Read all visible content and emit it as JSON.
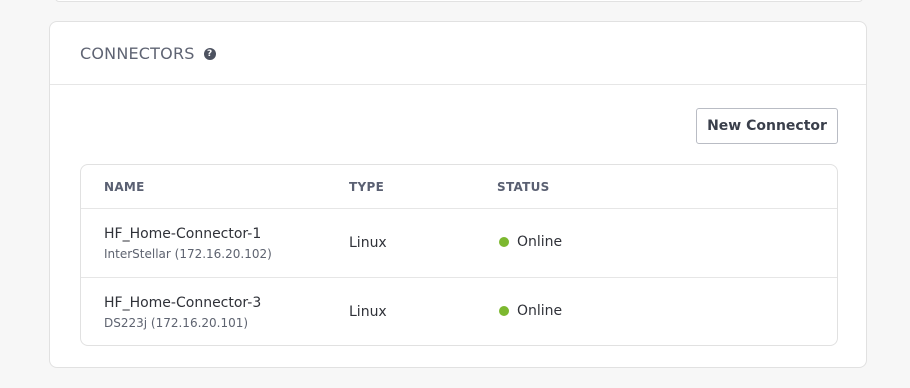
{
  "panel": {
    "title": "CONNECTORS",
    "help_icon": "question-circle-icon",
    "new_button_label": "New Connector"
  },
  "table": {
    "headers": {
      "name": "NAME",
      "type": "TYPE",
      "status": "STATUS"
    },
    "rows": [
      {
        "name": "HF_Home-Connector-1",
        "detail": "InterStellar (172.16.20.102)",
        "type": "Linux",
        "status": "Online"
      },
      {
        "name": "HF_Home-Connector-3",
        "detail": "DS223j (172.16.20.101)",
        "type": "Linux",
        "status": "Online"
      }
    ]
  },
  "colors": {
    "online": "#7cb82f",
    "text": "#2f3138",
    "muted": "#5f6473"
  }
}
